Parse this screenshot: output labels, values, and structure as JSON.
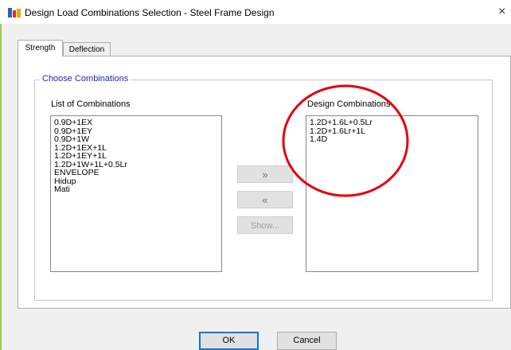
{
  "window": {
    "title": "Design Load Combinations Selection - Steel Frame Design",
    "close_glyph": "×"
  },
  "tabs": [
    {
      "label": "Strength",
      "selected": true
    },
    {
      "label": "Deflection",
      "selected": false
    }
  ],
  "group": {
    "label": "Choose Combinations"
  },
  "left_list": {
    "label": "List of Combinations",
    "items": [
      "0.9D+1EX",
      "0.9D+1EY",
      "0.9D+1W",
      "1.2D+1EX+1L",
      "1.2D+1EY+1L",
      "1.2D+1W+1L+0.5Lr",
      "ENVELOPE",
      "Hidup",
      "Mati"
    ]
  },
  "right_list": {
    "label": "Design Combinations",
    "items": [
      "1.2D+1.6L+0.5Lr",
      "1.2D+1.6Lr+1L",
      "1.4D"
    ]
  },
  "buttons": {
    "add": "»",
    "remove": "«",
    "show": "Show...",
    "ok": "OK",
    "cancel": "Cancel"
  },
  "annotation": {
    "color": "#e3000f",
    "shape": "ellipse"
  }
}
